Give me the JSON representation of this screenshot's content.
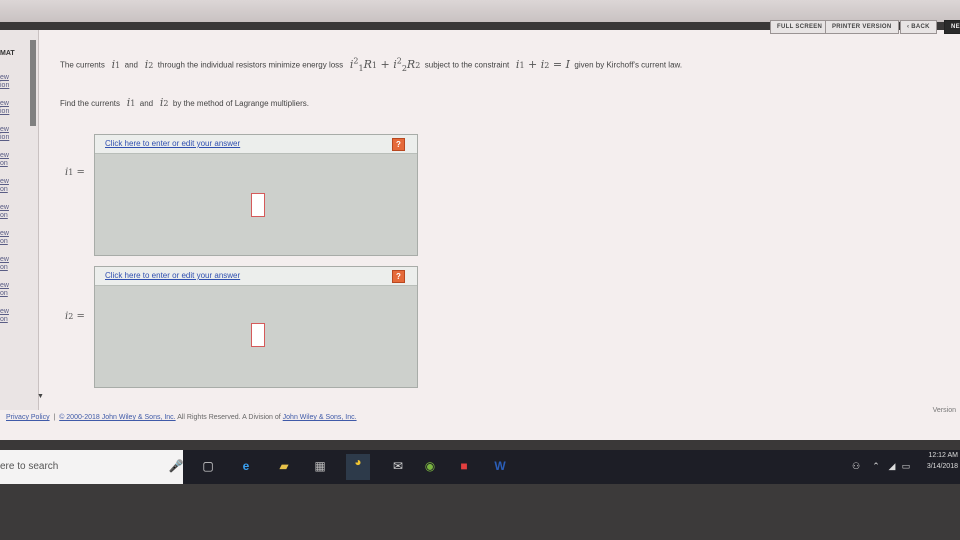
{
  "toolbar": {
    "full_screen": "FULL SCREEN",
    "printer_version": "PRINTER VERSION",
    "back": "‹ BACK",
    "next": "NE"
  },
  "leftnav": {
    "heading": "MAT",
    "items": [
      "ew",
      "ion",
      "ew",
      "ion",
      "ew",
      "ion",
      "ew",
      "on",
      "ew",
      "on",
      "ew",
      "on",
      "ew",
      "on",
      "ew",
      "on",
      "ew",
      "on",
      "ew",
      "on"
    ]
  },
  "question": {
    "line1_pre": "The currents",
    "and1": "and",
    "line1_mid": "through the individual resistors minimize energy loss",
    "plus1": "+",
    "subject": "subject to the constraint",
    "plus2": "+",
    "equals": "=",
    "I": "I",
    "kirchoff": "given by Kirchoff's current law.",
    "line2_pre": "Find the currents",
    "and2": "and",
    "line2_post": "by the method of Lagrange multipliers.",
    "i": "i",
    "sub1": "1",
    "sub2": "2",
    "R": "R",
    "sq": "2"
  },
  "answers": [
    {
      "link": "Click here to enter or edit your answer",
      "help": "?",
      "label": "i",
      "sub": "1",
      "eq": "="
    },
    {
      "link": "Click here to enter or edit your answer",
      "help": "?",
      "label": "i",
      "sub": "2",
      "eq": "="
    }
  ],
  "footer": {
    "privacy": "Privacy Policy",
    "sep": "|",
    "copyright": "© 2000-2018 John Wiley & Sons, Inc.",
    "rights": "All Rights Reserved. A Division of",
    "company": "John Wiley & Sons, Inc.",
    "version": "Version"
  },
  "taskbar": {
    "search": "ere to search",
    "time": "12:12 AM",
    "date": "3/14/2018"
  }
}
